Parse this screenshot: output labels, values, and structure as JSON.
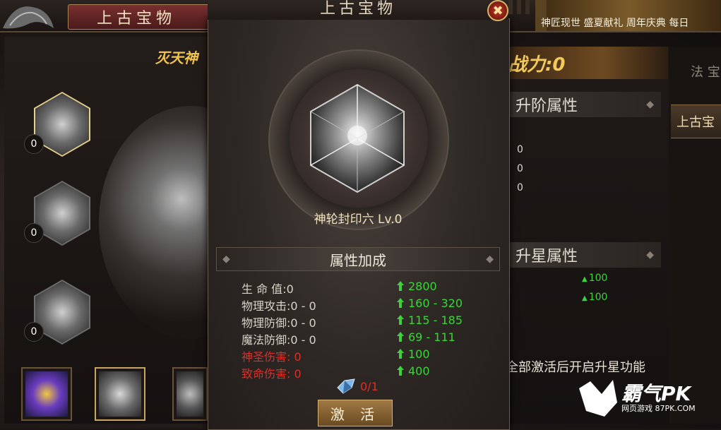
{
  "background": {
    "title": "上古宝物",
    "subtitle": "灭天神",
    "power_label": "战力:0",
    "section_upgrade": "升阶属性",
    "section_star": "升星属性",
    "upgrade_values": [
      "0",
      "0",
      "0"
    ],
    "star_values": [
      "100",
      "100"
    ],
    "hint": "全部激活后开启升星功能",
    "tab_fa": "法 宝",
    "tab_shanggu": "上古宝",
    "banner": "神匠现世 盛夏献礼 周年庆典 每日",
    "slot_counts": [
      "0",
      "0",
      "0"
    ]
  },
  "modal": {
    "title": "上古宝物",
    "close_icon": "close-icon",
    "item_name": "神轮封印六 Lv.0",
    "attr_header": "属性加成",
    "attributes": [
      {
        "label": "生 命 值:0",
        "bonus": "2800",
        "color": "normal"
      },
      {
        "label": "物理攻击:0 - 0",
        "bonus": "160 - 320",
        "color": "normal"
      },
      {
        "label": "物理防御:0 - 0",
        "bonus": "115 - 185",
        "color": "normal"
      },
      {
        "label": "魔法防御:0 - 0",
        "bonus": "69 - 111",
        "color": "normal"
      },
      {
        "label": "神圣伤害: 0",
        "bonus": "100",
        "color": "red"
      },
      {
        "label": "致命伤害: 0",
        "bonus": "400",
        "color": "red"
      }
    ],
    "material_count": "0/1",
    "activate_label": "激 活"
  },
  "watermark": {
    "brand": "霸气PK",
    "site": "网页游戏 87PK.COM"
  },
  "colors": {
    "green": "#3bd43b",
    "red": "#d9302a",
    "gold": "#f3c95c"
  }
}
